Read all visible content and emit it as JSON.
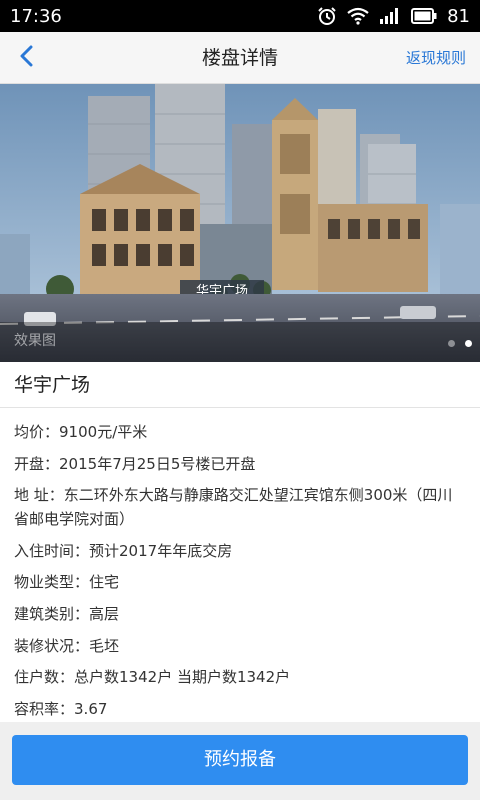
{
  "status_bar": {
    "time": "17:36",
    "battery": "81",
    "icons": [
      "alarm-icon",
      "wifi-icon",
      "signal-icon",
      "battery-icon"
    ]
  },
  "nav": {
    "back_icon": "chevron-left-icon",
    "title": "楼盘详情",
    "action": "返现规则"
  },
  "hero": {
    "caption": "效果图",
    "sign_text": "华宇广场",
    "page_count": 2,
    "active_index": 1
  },
  "property": {
    "name": "华宇广场",
    "details": [
      {
        "label": "均价：",
        "value": "9100元/平米"
      },
      {
        "label": "开盘：",
        "value": "2015年7月25日5号楼已开盘"
      },
      {
        "label": "地 址：",
        "value": "东二环外东大路与静康路交汇处望江宾馆东侧300米（四川省邮电学院对面）"
      },
      {
        "label": "入住时间：",
        "value": "预计2017年年底交房"
      },
      {
        "label": "物业类型：",
        "value": "住宅"
      },
      {
        "label": "建筑类别：",
        "value": "高层"
      },
      {
        "label": "装修状况：",
        "value": "毛坯"
      },
      {
        "label": "住户数：",
        "value": "总户数1342户 当期户数1342户"
      },
      {
        "label": "容积率：",
        "value": "3.67"
      }
    ]
  },
  "bottom": {
    "reserve_label": "预约报备"
  },
  "colors": {
    "accent": "#2f8df0",
    "link": "#2a78d6",
    "nav_bg": "#f6f6f6"
  }
}
